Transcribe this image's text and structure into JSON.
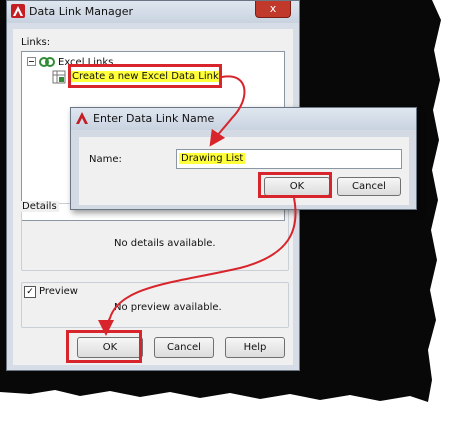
{
  "main_window": {
    "title": "Data Link Manager",
    "close_glyph": "x",
    "links_label": "Links:",
    "tree": {
      "root_label": "Excel Links",
      "expander": "−",
      "child_label": "Create a new Excel Data Link"
    },
    "details_label": "Details",
    "details_text": "No details available.",
    "preview_label": "Preview",
    "preview_checked": true,
    "preview_text": "No preview available.",
    "buttons": {
      "ok": "OK",
      "cancel": "Cancel",
      "help": "Help"
    }
  },
  "name_dialog": {
    "title": "Enter Data Link Name",
    "name_label": "Name:",
    "name_value": "Drawing List",
    "buttons": {
      "ok": "OK",
      "cancel": "Cancel"
    }
  },
  "colors": {
    "highlight_red": "#d8242b",
    "highlight_yellow": "#ffff3a",
    "titlebar": "#cfd8e3",
    "close_red": "#c0392b"
  },
  "icons": [
    "autocad-logo-icon",
    "close-icon",
    "tree-expander-icon",
    "excel-links-icon",
    "new-data-link-icon",
    "checkbox-icon",
    "annotation-arrow-icon"
  ]
}
